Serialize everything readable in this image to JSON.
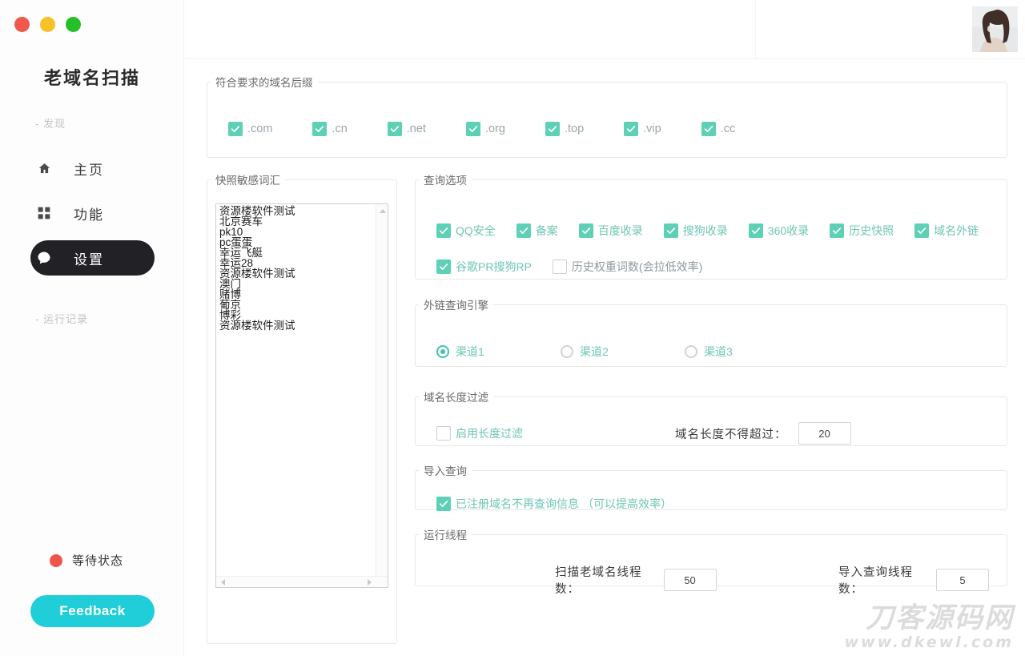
{
  "window": {
    "traffic_lights": [
      {
        "name": "close",
        "color": "#f0584c"
      },
      {
        "name": "minimize",
        "color": "#f7c127"
      },
      {
        "name": "maximize",
        "color": "#25bf2a"
      }
    ]
  },
  "sidebar": {
    "app_title": "老域名扫描",
    "groups": [
      {
        "label": "- 发现"
      },
      {
        "label": "- 运行记录"
      }
    ],
    "items": [
      {
        "label": "主页",
        "icon": "home-icon",
        "active": false
      },
      {
        "label": "功能",
        "icon": "grid-icon",
        "active": false
      },
      {
        "label": "设置",
        "icon": "chat-bubble-icon",
        "active": true
      }
    ],
    "status": {
      "text": "等待状态",
      "color": "#f0544a"
    },
    "feedback_label": "Feedback",
    "feedback_color": "#20ceda"
  },
  "topbar": {
    "avatar_alt": "user-avatar"
  },
  "suffix_panel": {
    "legend": "符合要求的域名后缀",
    "options": [
      {
        "label": ".com",
        "checked": true
      },
      {
        "label": ".cn",
        "checked": true
      },
      {
        "label": ".net",
        "checked": true
      },
      {
        "label": ".org",
        "checked": true
      },
      {
        "label": ".top",
        "checked": true
      },
      {
        "label": ".vip",
        "checked": true
      },
      {
        "label": ".cc",
        "checked": true
      }
    ]
  },
  "words_panel": {
    "legend": "快照敏感词汇",
    "text": "资源楼软件测试\n北京赛车\npk10\npc蛋蛋\n幸运飞艇\n幸运28\n资源楼软件测试\n澳门\n赌博\n葡京\n博彩\n资源楼软件测试"
  },
  "query_panel": {
    "legend": "查询选项",
    "row1": [
      {
        "label": "QQ安全",
        "checked": true
      },
      {
        "label": "备案",
        "checked": true
      },
      {
        "label": "百度收录",
        "checked": true
      },
      {
        "label": "搜狗收录",
        "checked": true
      },
      {
        "label": "360收录",
        "checked": true
      },
      {
        "label": "历史快照",
        "checked": true
      },
      {
        "label": "域名外链",
        "checked": true
      }
    ],
    "row2": [
      {
        "label": "谷歌PR搜狗RP",
        "checked": true
      },
      {
        "label": "历史权重词数(会拉低效率)",
        "checked": false
      }
    ]
  },
  "engine_panel": {
    "legend": "外链查询引擎",
    "options": [
      {
        "label": "渠道1",
        "selected": true
      },
      {
        "label": "渠道2",
        "selected": false
      },
      {
        "label": "渠道3",
        "selected": false
      }
    ]
  },
  "length_panel": {
    "legend": "域名长度过滤",
    "enable_label": "启用长度过滤",
    "enable_checked": false,
    "max_label": "域名长度不得超过：",
    "max_value": "20"
  },
  "import_panel": {
    "legend": "导入查询",
    "checkbox_label": "已注册域名不再查询信息",
    "checkbox_note": "（可以提高效率）",
    "checked": true
  },
  "threads_panel": {
    "legend": "运行线程",
    "scan_label": "扫描老域名线程数：",
    "scan_value": "50",
    "import_label": "导入查询线程数：",
    "import_value": "5"
  },
  "watermark": {
    "cn": "刀客源码网",
    "en": "www.dkewl.com"
  },
  "colors": {
    "accent_teal": "#5dd0b6",
    "feedback": "#20ceda",
    "active_nav": "#222226",
    "label_teal": "#6ec6b4"
  }
}
